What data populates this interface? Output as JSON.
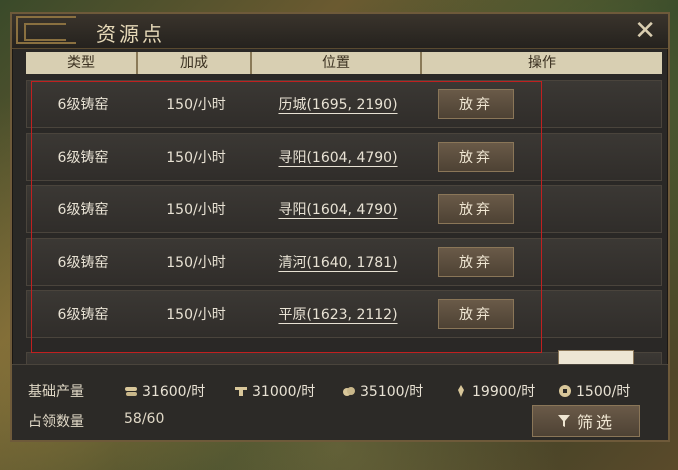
{
  "window": {
    "title": "资源点",
    "close_icon": "close-icon"
  },
  "table": {
    "headers": [
      "类型",
      "加成",
      "位置",
      "操作"
    ],
    "rows": [
      {
        "type": "6级铸窑",
        "bonus": "150/小时",
        "location": "历城(1695, 2190)",
        "action": "放弃"
      },
      {
        "type": "6级铸窑",
        "bonus": "150/小时",
        "location": "寻阳(1604, 4790)",
        "action": "放弃"
      },
      {
        "type": "6级铸窑",
        "bonus": "150/小时",
        "location": "寻阳(1604, 4790)",
        "action": "放弃"
      },
      {
        "type": "6级铸窑",
        "bonus": "150/小时",
        "location": "清河(1640, 1781)",
        "action": "放弃"
      },
      {
        "type": "6级铸窑",
        "bonus": "150/小时",
        "location": "平原(1623, 2112)",
        "action": "放弃"
      }
    ]
  },
  "footer": {
    "base_output_label": "基础产量",
    "resources": [
      {
        "icon": "wood-icon",
        "value": "31600/时"
      },
      {
        "icon": "iron-icon",
        "value": "31000/时"
      },
      {
        "icon": "stone-icon",
        "value": "35100/时"
      },
      {
        "icon": "grain-icon",
        "value": "19900/时"
      },
      {
        "icon": "coin-icon",
        "value": "1500/时"
      }
    ],
    "occupied_label": "占领数量",
    "occupied_value": "58/60",
    "filter_label": "筛选"
  },
  "colors": {
    "highlight_box": "#c02020",
    "accent": "#8a7040"
  }
}
